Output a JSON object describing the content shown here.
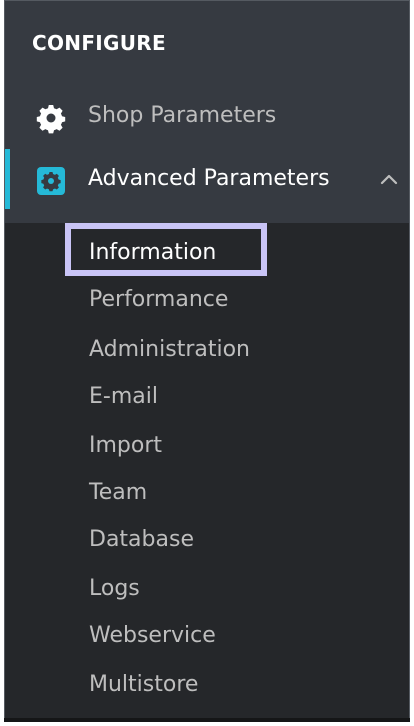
{
  "section": {
    "title": "CONFIGURE"
  },
  "menu": {
    "shop_parameters": {
      "label": "Shop Parameters",
      "icon": "gear-icon"
    },
    "advanced_parameters": {
      "label": "Advanced Parameters",
      "icon": "gear-box-icon",
      "expanded": true,
      "chevron": "chevron-up-icon"
    }
  },
  "submenu": {
    "items": [
      {
        "label": "Information",
        "active": true
      },
      {
        "label": "Performance",
        "active": false
      },
      {
        "label": "Administration",
        "active": false
      },
      {
        "label": "E-mail",
        "active": false
      },
      {
        "label": "Import",
        "active": false
      },
      {
        "label": "Team",
        "active": false
      },
      {
        "label": "Database",
        "active": false
      },
      {
        "label": "Logs",
        "active": false
      },
      {
        "label": "Webservice",
        "active": false
      },
      {
        "label": "Multistore",
        "active": false
      }
    ]
  },
  "colors": {
    "sidebar_bg": "#363a41",
    "submenu_bg": "#25272a",
    "accent": "#25b9d7",
    "highlight": "#c9c4f6",
    "muted_text": "#bebebe",
    "active_text": "#ffffff"
  }
}
